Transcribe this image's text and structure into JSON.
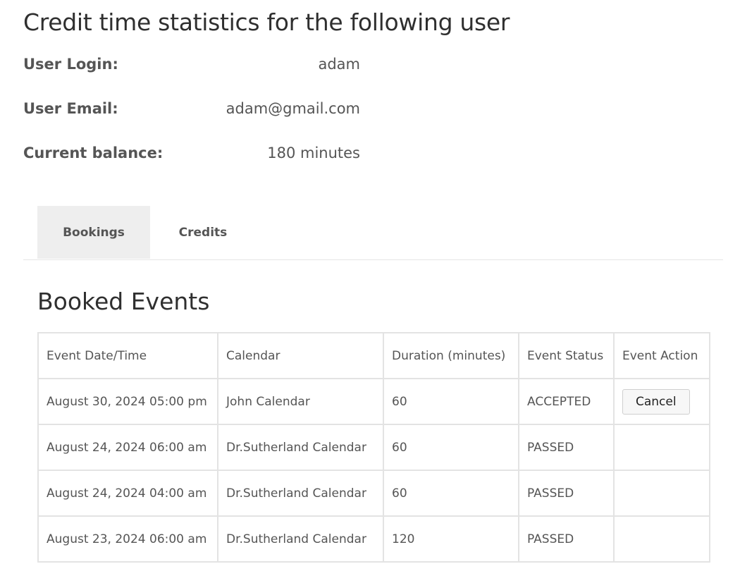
{
  "header": {
    "title": "Credit time statistics for the following user"
  },
  "user": {
    "login_label": "User Login:",
    "login_value": "adam",
    "email_label": "User Email:",
    "email_value": "adam@gmail.com",
    "balance_label": "Current balance:",
    "balance_value": "180 minutes"
  },
  "tabs": [
    {
      "label": "Bookings",
      "active": true
    },
    {
      "label": "Credits",
      "active": false
    }
  ],
  "booked": {
    "title": "Booked Events",
    "columns": [
      "Event Date/Time",
      "Calendar",
      "Duration (minutes)",
      "Event Status",
      "Event Action"
    ],
    "rows": [
      {
        "datetime": "August 30, 2024 05:00 pm",
        "calendar": "John Calendar",
        "duration": "60",
        "status": "ACCEPTED",
        "action": "Cancel"
      },
      {
        "datetime": "August 24, 2024 06:00 am",
        "calendar": "Dr.Sutherland Calendar",
        "duration": "60",
        "status": "PASSED",
        "action": ""
      },
      {
        "datetime": "August 24, 2024 04:00 am",
        "calendar": "Dr.Sutherland Calendar",
        "duration": "60",
        "status": "PASSED",
        "action": ""
      },
      {
        "datetime": "August 23, 2024 06:00 am",
        "calendar": "Dr.Sutherland Calendar",
        "duration": "120",
        "status": "PASSED",
        "action": ""
      }
    ]
  }
}
